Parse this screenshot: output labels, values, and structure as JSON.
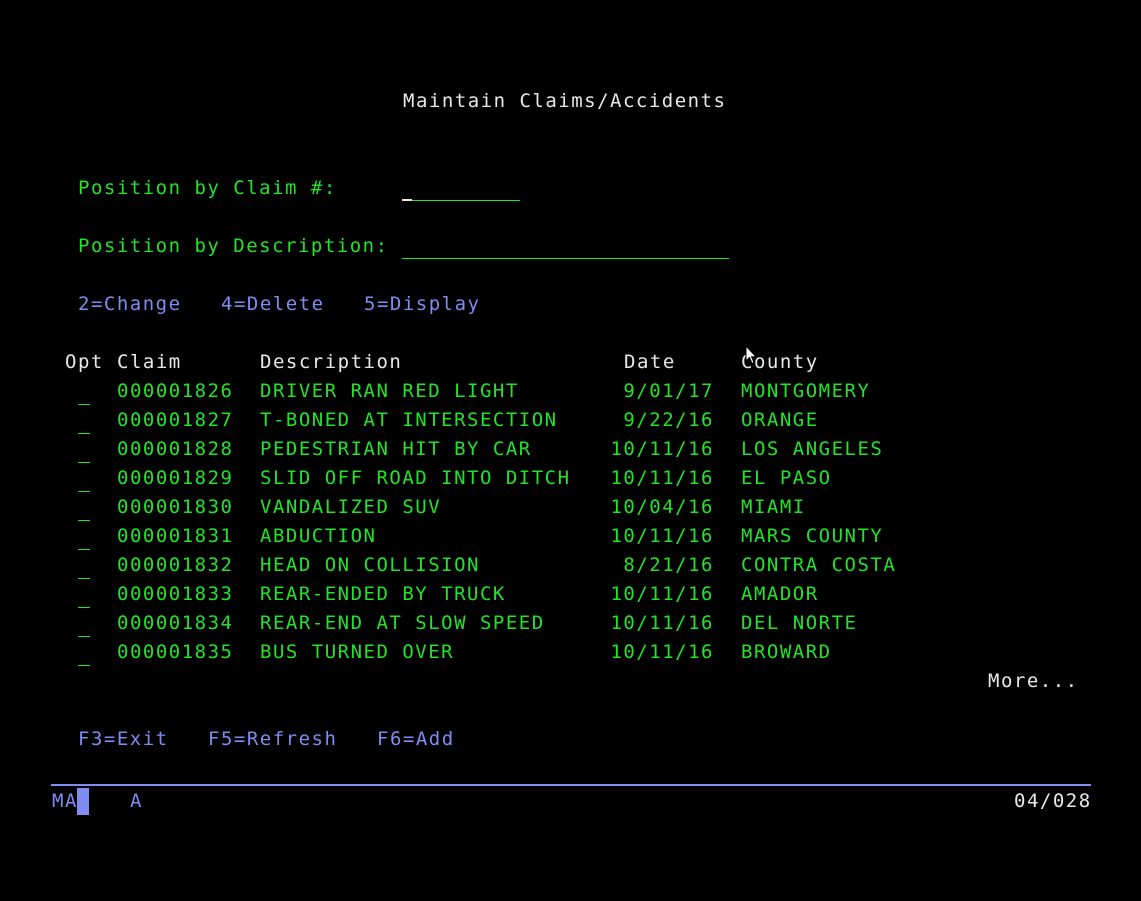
{
  "screen": {
    "title": "Maintain Claims/Accidents"
  },
  "position": {
    "claim_label": "Position by Claim #:",
    "claim_value": "",
    "description_label": "Position by Description:",
    "description_value": ""
  },
  "options": {
    "change": "2=Change",
    "delete": "4=Delete",
    "display": "5=Display"
  },
  "columns": {
    "opt": "Opt",
    "claim": "Claim",
    "description": "Description",
    "date": "Date",
    "county": "County"
  },
  "rows": [
    {
      "opt": "",
      "claim": "000001826",
      "description": "DRIVER RAN RED LIGHT",
      "date": "9/01/17",
      "county": "MONTGOMERY"
    },
    {
      "opt": "",
      "claim": "000001827",
      "description": "T-BONED AT INTERSECTION",
      "date": "9/22/16",
      "county": "ORANGE"
    },
    {
      "opt": "",
      "claim": "000001828",
      "description": "PEDESTRIAN HIT BY CAR",
      "date": "10/11/16",
      "county": "LOS ANGELES"
    },
    {
      "opt": "",
      "claim": "000001829",
      "description": "SLID OFF ROAD INTO DITCH",
      "date": "10/11/16",
      "county": "EL PASO"
    },
    {
      "opt": "",
      "claim": "000001830",
      "description": "VANDALIZED SUV",
      "date": "10/04/16",
      "county": "MIAMI"
    },
    {
      "opt": "",
      "claim": "000001831",
      "description": "ABDUCTION",
      "date": "10/11/16",
      "county": "MARS COUNTY"
    },
    {
      "opt": "",
      "claim": "000001832",
      "description": "HEAD ON COLLISION",
      "date": "8/21/16",
      "county": "CONTRA COSTA"
    },
    {
      "opt": "",
      "claim": "000001833",
      "description": "REAR-ENDED BY TRUCK",
      "date": "10/11/16",
      "county": "AMADOR"
    },
    {
      "opt": "",
      "claim": "000001834",
      "description": "REAR-END AT SLOW SPEED",
      "date": "10/11/16",
      "county": "DEL NORTE"
    },
    {
      "opt": "",
      "claim": "000001835",
      "description": "BUS TURNED OVER",
      "date": "10/11/16",
      "county": "BROWARD"
    }
  ],
  "more": "More...",
  "function_keys": {
    "exit": "F3=Exit",
    "refresh": "F5=Refresh",
    "add": "F6=Add"
  },
  "status": {
    "indicator_left": "MA",
    "indicator_mode": "A",
    "cursor_position": "04/028"
  },
  "colors": {
    "background": "#000000",
    "heading": "#e8e8e8",
    "input_text": "#22e22a",
    "function_text": "#7f8cf2"
  },
  "icons": {
    "mouse": "mouse-pointer-icon"
  }
}
